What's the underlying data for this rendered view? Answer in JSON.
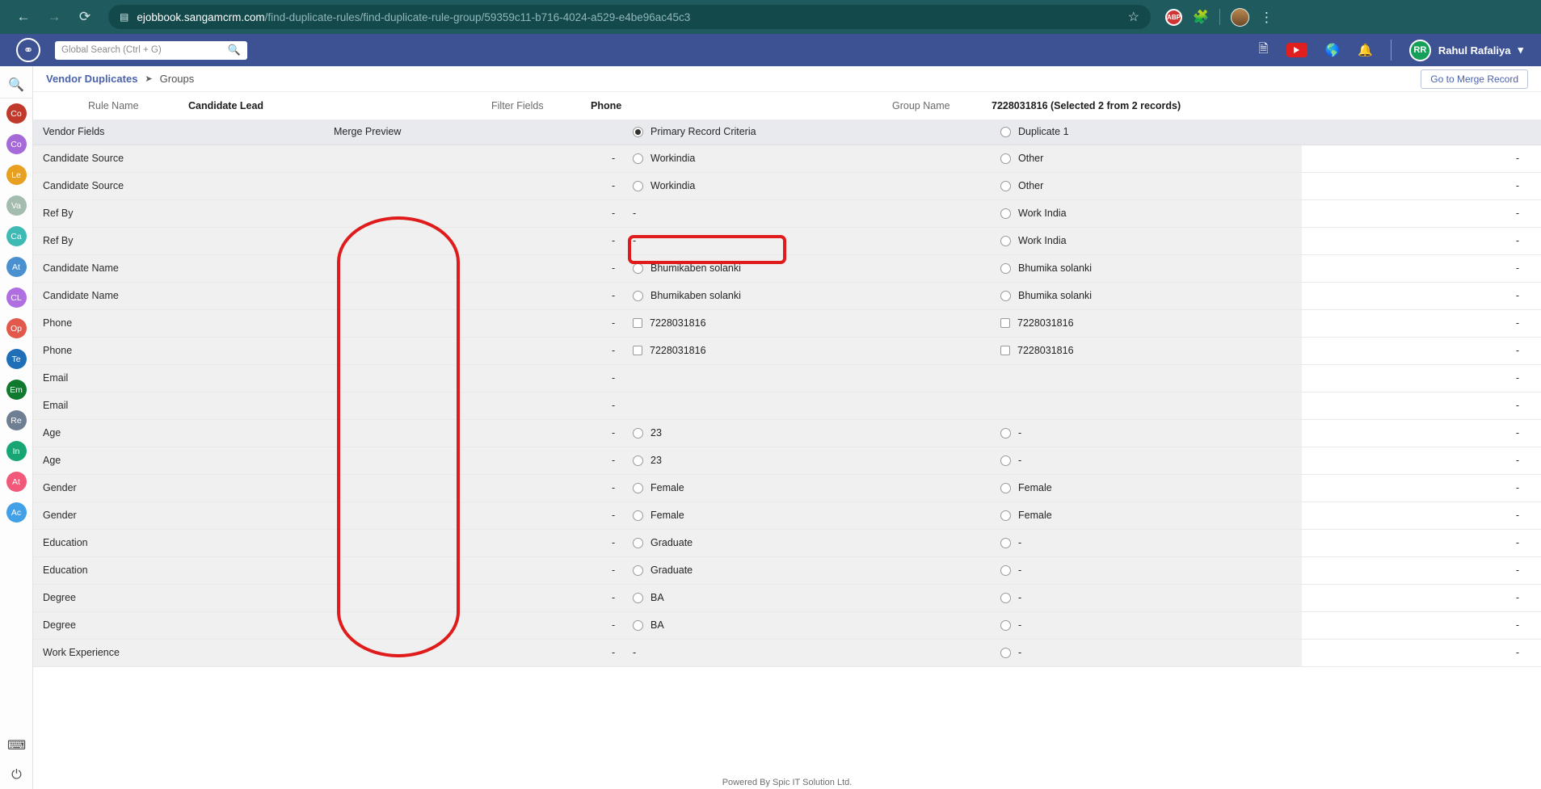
{
  "browser": {
    "back_icon": "back-arrow-icon",
    "forward_icon": "forward-arrow-icon",
    "reload_icon": "reload-icon",
    "url_domain": "ejobbook.sangamcrm.com",
    "url_path": "/find-duplicate-rules/find-duplicate-rule-group/59359c11-b716-4024-a529-e4be96ac45c3",
    "bookmark_icon": "star-icon",
    "extension_abp_label": "ABP",
    "extensions_icon": "puzzle-piece-icon",
    "profile_icon": "profile-avatar-icon",
    "menu_icon": "kebab-menu-icon",
    "chrome_bg": "#1f5b5e"
  },
  "app_header": {
    "logo_icon": "sangam-logo-icon",
    "search_placeholder": "Global Search (Ctrl + G)",
    "search_value": "",
    "search_icon": "search-icon",
    "icons": [
      {
        "name": "document-search-icon",
        "glyph": "⬚"
      },
      {
        "name": "youtube-icon",
        "glyph": "▶"
      },
      {
        "name": "globe-help-icon",
        "glyph": "◔"
      },
      {
        "name": "notification-bell-icon",
        "glyph": "🔔"
      }
    ],
    "user_initials": "RR",
    "user_name": "Rahul Rafaliya",
    "user_caret": "▾",
    "bg": "#3c5293"
  },
  "sidebar": {
    "search_icon": "search-icon",
    "items": [
      {
        "label": "Co",
        "color": "#c0392b"
      },
      {
        "label": "Co",
        "color": "#a569d8"
      },
      {
        "label": "Le",
        "color": "#e8a023"
      },
      {
        "label": "Va",
        "color": "#a3bcae"
      },
      {
        "label": "Ca",
        "color": "#3fb9b4"
      },
      {
        "label": "At",
        "color": "#4a8fd0"
      },
      {
        "label": "CL",
        "color": "#b06fe0"
      },
      {
        "label": "Op",
        "color": "#e2584a"
      },
      {
        "label": "Te",
        "color": "#1f6fb8"
      },
      {
        "label": "Em",
        "color": "#0f7a2e"
      },
      {
        "label": "Re",
        "color": "#6f7f93"
      },
      {
        "label": "In",
        "color": "#17a673"
      },
      {
        "label": "At",
        "color": "#f2587a"
      },
      {
        "label": "Ac",
        "color": "#41a0e6"
      }
    ],
    "bottom_icons": [
      {
        "name": "keyboard-icon",
        "glyph": "⌨"
      },
      {
        "name": "power-icon",
        "glyph": "⏻"
      }
    ]
  },
  "breadcrumb": {
    "parent": "Vendor Duplicates",
    "separator": "➤",
    "current": "Groups",
    "action_button": "Go to Merge Record"
  },
  "info_strip": {
    "rule_name_label": "Rule Name",
    "rule_name_value": "Candidate Lead",
    "filter_fields_label": "Filter Fields",
    "filter_fields_value": "Phone",
    "group_name_label": "Group Name",
    "group_name_value": "7228031816 (Selected 2 from 2 records)"
  },
  "table": {
    "headers": {
      "vendor_fields": "Vendor Fields",
      "merge_preview": "Merge Preview",
      "primary_record": "Primary Record Criteria",
      "duplicate_1": "Duplicate 1",
      "last": ""
    },
    "primary_selected": true,
    "duplicate_selected": false,
    "rows": [
      {
        "field": "Candidate Source",
        "merge": "-",
        "primary": {
          "type": "radio",
          "value": "Workindia",
          "selected": false
        },
        "duplicate": {
          "type": "radio",
          "value": "Other",
          "selected": false
        },
        "last": "-"
      },
      {
        "field": "Candidate Source",
        "merge": "-",
        "primary": {
          "type": "radio",
          "value": "Workindia",
          "selected": false
        },
        "duplicate": {
          "type": "radio",
          "value": "Other",
          "selected": false
        },
        "last": "-"
      },
      {
        "field": "Ref By",
        "merge": "-",
        "primary": {
          "type": "text",
          "value": "-"
        },
        "duplicate": {
          "type": "radio",
          "value": "Work India",
          "selected": false
        },
        "last": "-"
      },
      {
        "field": "Ref By",
        "merge": "-",
        "primary": {
          "type": "text",
          "value": "-"
        },
        "duplicate": {
          "type": "radio",
          "value": "Work India",
          "selected": false
        },
        "last": "-"
      },
      {
        "field": "Candidate Name",
        "merge": "-",
        "primary": {
          "type": "radio",
          "value": "Bhumikaben solanki",
          "selected": false
        },
        "duplicate": {
          "type": "radio",
          "value": "Bhumika solanki",
          "selected": false
        },
        "last": "-"
      },
      {
        "field": "Candidate Name",
        "merge": "-",
        "primary": {
          "type": "radio",
          "value": "Bhumikaben solanki",
          "selected": false
        },
        "duplicate": {
          "type": "radio",
          "value": "Bhumika solanki",
          "selected": false
        },
        "last": "-"
      },
      {
        "field": "Phone",
        "merge": "-",
        "primary": {
          "type": "checkbox",
          "value": "7228031816",
          "selected": false
        },
        "duplicate": {
          "type": "checkbox",
          "value": "7228031816",
          "selected": false
        },
        "last": "-"
      },
      {
        "field": "Phone",
        "merge": "-",
        "primary": {
          "type": "checkbox",
          "value": "7228031816",
          "selected": false
        },
        "duplicate": {
          "type": "checkbox",
          "value": "7228031816",
          "selected": false
        },
        "last": "-"
      },
      {
        "field": "Email",
        "merge": "-",
        "primary": {
          "type": "empty",
          "value": ""
        },
        "duplicate": {
          "type": "empty",
          "value": ""
        },
        "last": "-"
      },
      {
        "field": "Email",
        "merge": "-",
        "primary": {
          "type": "empty",
          "value": ""
        },
        "duplicate": {
          "type": "empty",
          "value": ""
        },
        "last": "-"
      },
      {
        "field": "Age",
        "merge": "-",
        "primary": {
          "type": "radio",
          "value": "23",
          "selected": false
        },
        "duplicate": {
          "type": "radio",
          "value": "-",
          "selected": false
        },
        "last": "-"
      },
      {
        "field": "Age",
        "merge": "-",
        "primary": {
          "type": "radio",
          "value": "23",
          "selected": false
        },
        "duplicate": {
          "type": "radio",
          "value": "-",
          "selected": false
        },
        "last": "-"
      },
      {
        "field": "Gender",
        "merge": "-",
        "primary": {
          "type": "radio",
          "value": "Female",
          "selected": false
        },
        "duplicate": {
          "type": "radio",
          "value": "Female",
          "selected": false
        },
        "last": "-"
      },
      {
        "field": "Gender",
        "merge": "-",
        "primary": {
          "type": "radio",
          "value": "Female",
          "selected": false
        },
        "duplicate": {
          "type": "radio",
          "value": "Female",
          "selected": false
        },
        "last": "-"
      },
      {
        "field": "Education",
        "merge": "-",
        "primary": {
          "type": "radio",
          "value": "Graduate",
          "selected": false
        },
        "duplicate": {
          "type": "radio",
          "value": "-",
          "selected": false
        },
        "last": "-"
      },
      {
        "field": "Education",
        "merge": "-",
        "primary": {
          "type": "radio",
          "value": "Graduate",
          "selected": false
        },
        "duplicate": {
          "type": "radio",
          "value": "-",
          "selected": false
        },
        "last": "-"
      },
      {
        "field": "Degree",
        "merge": "-",
        "primary": {
          "type": "radio",
          "value": "BA",
          "selected": false
        },
        "duplicate": {
          "type": "radio",
          "value": "-",
          "selected": false
        },
        "last": "-"
      },
      {
        "field": "Degree",
        "merge": "-",
        "primary": {
          "type": "radio",
          "value": "BA",
          "selected": false
        },
        "duplicate": {
          "type": "radio",
          "value": "-",
          "selected": false
        },
        "last": "-"
      },
      {
        "field": "Work Experience",
        "merge": "-",
        "primary": {
          "type": "text",
          "value": "-"
        },
        "duplicate": {
          "type": "radio",
          "value": "-",
          "selected": false
        },
        "last": "-"
      }
    ]
  },
  "annotations": {
    "oval_color": "#e01b1b",
    "rect_color": "#e01b1b"
  },
  "footer": {
    "text": "Powered By Spic IT Solution Ltd."
  }
}
